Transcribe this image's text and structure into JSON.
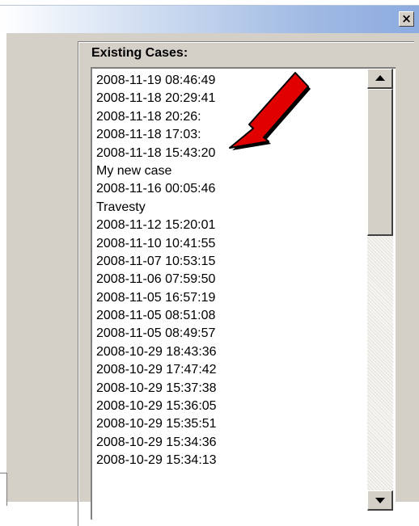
{
  "dialog": {
    "close_glyph": "×",
    "section_label": "Existing Cases:",
    "cases": [
      "2008-11-19 08:46:49",
      "2008-11-18 20:29:41",
      "2008-11-18 20:26:",
      "2008-11-18 17:03:",
      "2008-11-18 15:43:20",
      "My new case",
      "2008-11-16 00:05:46",
      "Travesty",
      "2008-11-12 15:20:01",
      "2008-11-10 10:41:55",
      "2008-11-07 10:53:15",
      "2008-11-06 07:59:50",
      "2008-11-05 16:57:19",
      "2008-11-05 08:51:08",
      "2008-11-05 08:49:57",
      "2008-10-29 18:43:36",
      "2008-10-29 17:47:42",
      "2008-10-29 15:37:38",
      "2008-10-29 15:36:05",
      "2008-10-29 15:35:51",
      "2008-10-29 15:34:36",
      "2008-10-29 15:34:13"
    ]
  },
  "annotation": {
    "icon": "red-arrow-icon",
    "color": "#e00000"
  },
  "colors": {
    "face": "#d4d0c8",
    "title_gradient_end": "#8cabe0"
  }
}
